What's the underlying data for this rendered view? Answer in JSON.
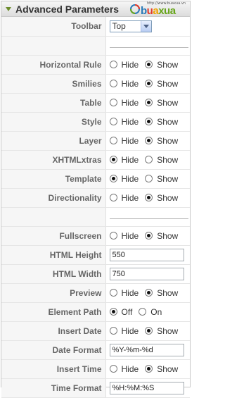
{
  "header": {
    "title": "Advanced Parameters",
    "logo_tagline": "http://www.buaxua.vn",
    "logo_text_b": "b",
    "logo_text_u": "u",
    "logo_text_a": "a",
    "logo_text_x": "xua"
  },
  "labels": {
    "hide": "Hide",
    "show": "Show",
    "off": "Off",
    "on": "On"
  },
  "toolbar": {
    "label": "Toolbar",
    "value": "Top"
  },
  "horizontal_rule": {
    "label": "Horizontal Rule",
    "selected": "show"
  },
  "smilies": {
    "label": "Smilies",
    "selected": "show"
  },
  "table": {
    "label": "Table",
    "selected": "show"
  },
  "style": {
    "label": "Style",
    "selected": "show"
  },
  "layer": {
    "label": "Layer",
    "selected": "show"
  },
  "xhtmlxtras": {
    "label": "XHTMLxtras",
    "selected": "hide"
  },
  "template": {
    "label": "Template",
    "selected": "hide"
  },
  "directionality": {
    "label": "Directionality",
    "selected": "show"
  },
  "fullscreen": {
    "label": "Fullscreen",
    "selected": "show"
  },
  "html_height": {
    "label": "HTML Height",
    "value": "550"
  },
  "html_width": {
    "label": "HTML Width",
    "value": "750"
  },
  "preview": {
    "label": "Preview",
    "selected": "show"
  },
  "element_path": {
    "label": "Element Path",
    "selected": "off"
  },
  "insert_date": {
    "label": "Insert Date",
    "selected": "show"
  },
  "date_format": {
    "label": "Date Format",
    "value": "%Y-%m-%d"
  },
  "insert_time": {
    "label": "Insert Time",
    "selected": "show"
  },
  "time_format": {
    "label": "Time Format",
    "value": "%H:%M:%S"
  }
}
